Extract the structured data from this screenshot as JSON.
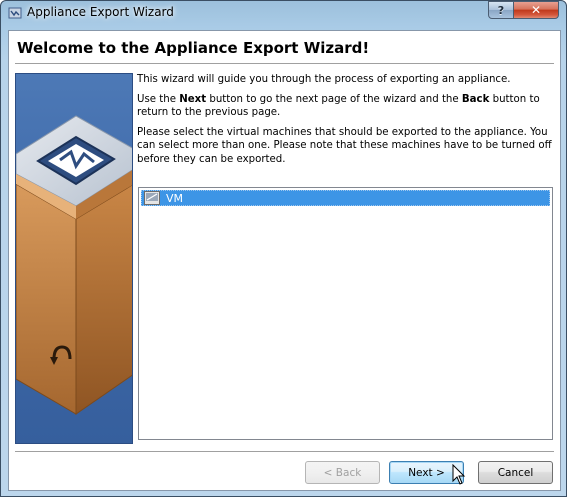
{
  "window": {
    "title": "Appliance Export Wizard",
    "help_label": "?",
    "close_label": "✕"
  },
  "page": {
    "title": "Welcome to the Appliance Export Wizard!",
    "intro_1": "This wizard will guide you through the process of exporting an appliance.",
    "intro_2_pre": "Use the ",
    "intro_2_next": "Next",
    "intro_2_mid": " button to go the next page of the wizard and the ",
    "intro_2_back": "Back",
    "intro_2_post": " button to return to the previous page.",
    "intro_3": "Please select the virtual machines that should be exported to the appliance. You can select more than one. Please note that these machines have to be turned off before they can be exported."
  },
  "vm_list": {
    "items": [
      {
        "label": "VM",
        "selected": true,
        "icon": "vm-os-icon"
      }
    ]
  },
  "buttons": {
    "back": "< Back",
    "next": "Next >",
    "cancel": "Cancel"
  },
  "colors": {
    "selection": "#3d95e6",
    "side_banner": "#3f6aaa",
    "box_brown": "#c6874a"
  }
}
